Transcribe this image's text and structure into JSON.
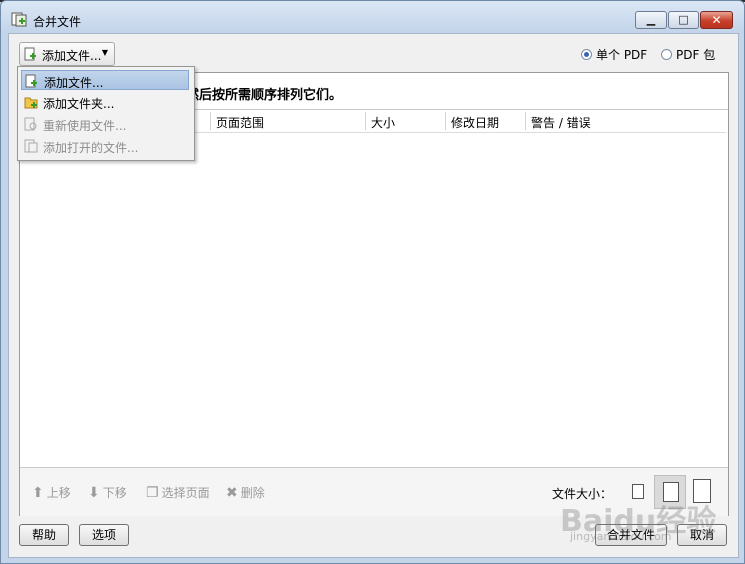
{
  "window": {
    "title": "合并文件"
  },
  "toolbar": {
    "add_files_label": "添加文件...",
    "mode_single": "单个 PDF",
    "mode_package": "PDF 包"
  },
  "instruction": "然后按所需顺序排列它们。",
  "columns": [
    "页面范围",
    "大小",
    "修改日期",
    "警告 / 错误"
  ],
  "menu": {
    "items": [
      {
        "label": "添加文件...",
        "state": "highlighted"
      },
      {
        "label": "添加文件夹...",
        "state": "enabled"
      },
      {
        "label": "重新使用文件...",
        "state": "disabled"
      },
      {
        "label": "添加打开的文件...",
        "state": "disabled"
      }
    ]
  },
  "list_tools": {
    "move_up": "上移",
    "move_down": "下移",
    "choose_pages": "选择页面",
    "delete": "删除"
  },
  "file_size_label": "文件大小：",
  "footer": {
    "help": "帮助",
    "options": "选项",
    "merge": "合并文件",
    "cancel": "取消"
  },
  "watermark": {
    "brand": "Baidu经验",
    "url": "jingyan.baidu.com"
  },
  "colors": {
    "highlight": "#aac4e3",
    "close_button": "#c8402a"
  }
}
